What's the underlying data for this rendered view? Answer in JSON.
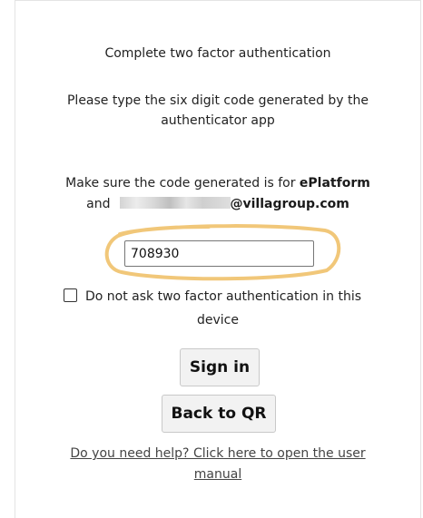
{
  "auth": {
    "title": "Complete two factor authentication",
    "instruction_line1": "Please type the six digit code generated by the",
    "instruction_line2": "authenticator app",
    "make_sure_prefix": "Make sure the code generated is for ",
    "platform_name": "ePlatform",
    "and_text": "and",
    "email_domain": "@villagroup.com",
    "code_value": "708930",
    "remember_label_line1": "Do not ask two factor authentication in this",
    "remember_label_line2": "device",
    "remember_checked": false,
    "signin_label": "Sign in",
    "back_label": "Back to QR",
    "help_line1": "Do you need help? Click here to open the user",
    "help_line2": "manual"
  },
  "colors": {
    "highlight": "#f0c16a",
    "button_bg": "#f2f2f2",
    "border": "#767676"
  }
}
